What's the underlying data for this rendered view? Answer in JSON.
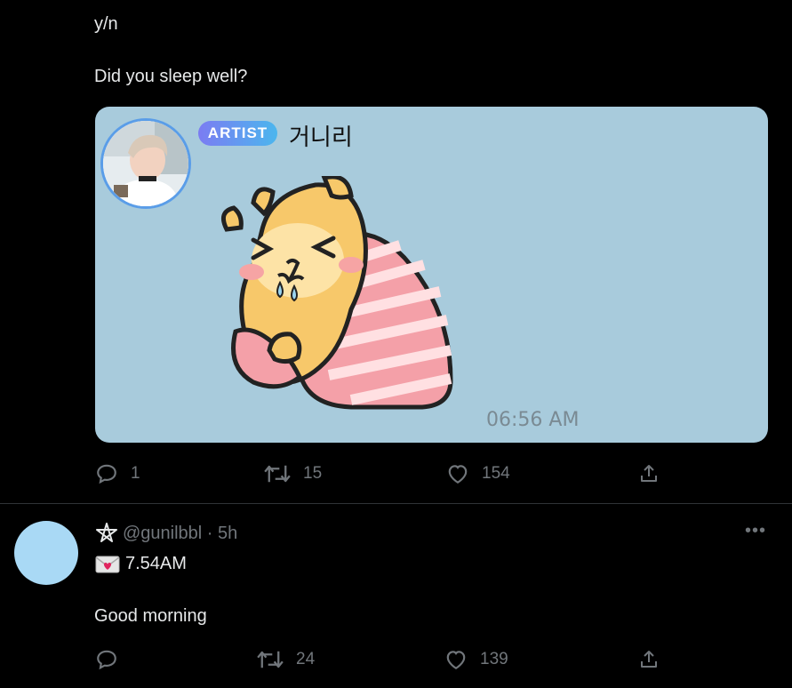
{
  "tweet1": {
    "line1": "y/n",
    "line2": "Did you sleep well?",
    "card": {
      "badge": "ARTIST",
      "name": "거니리",
      "time": "06:56 AM"
    },
    "actions": {
      "replies": "1",
      "retweets": "15",
      "likes": "154"
    }
  },
  "tweet2": {
    "handle": "@gunilbbl · 5h",
    "line1": "7.54AM",
    "line2": "Good morning",
    "actions": {
      "replies": "",
      "retweets": "24",
      "likes": "139"
    }
  },
  "icons": {
    "reply": "reply-icon",
    "retweet": "retweet-icon",
    "like": "heart-icon",
    "share": "share-icon",
    "pentagram": "pentagram-icon",
    "envelope": "love-letter-icon",
    "more": "more-icon"
  },
  "colors": {
    "background": "#000000",
    "card": "#a8cbdc",
    "muted": "#71767b",
    "badge_start": "#7b7cf2",
    "badge_end": "#4bb6ee",
    "avatar2": "#a9d9f5"
  }
}
